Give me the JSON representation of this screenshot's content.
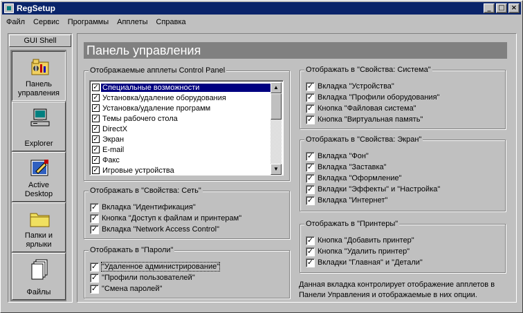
{
  "window": {
    "title": "RegSetup",
    "minimize_glyph": "_",
    "maximize_glyph": "□",
    "close_glyph": "×"
  },
  "menu": [
    "Файл",
    "Сервис",
    "Программы",
    "Апплеты",
    "Справка"
  ],
  "sidebar": {
    "header": "GUI Shell",
    "items": [
      {
        "label_line1": "Панель",
        "label_line2": "управления",
        "icon": "control-panel-icon",
        "active": true
      },
      {
        "label_line1": "Explorer",
        "label_line2": "",
        "icon": "computer-icon",
        "active": false
      },
      {
        "label_line1": "Active",
        "label_line2": "Desktop",
        "icon": "active-desktop-icon",
        "active": false
      },
      {
        "label_line1": "Папки и",
        "label_line2": "ярлыки",
        "icon": "folder-icon",
        "active": false
      },
      {
        "label_line1": "Файлы",
        "label_line2": "",
        "icon": "files-icon",
        "active": false
      }
    ]
  },
  "main": {
    "title": "Панель управления",
    "applets_group": {
      "legend": "Отображаемые апплеты Control Panel",
      "items": [
        {
          "label": "Специальные возможности",
          "checked": true,
          "selected": true
        },
        {
          "label": "Установка/удаление оборудования",
          "checked": true
        },
        {
          "label": "Установка/удаление программ",
          "checked": true
        },
        {
          "label": "Темы рабочего стола",
          "checked": true
        },
        {
          "label": "DirectX",
          "checked": true
        },
        {
          "label": "Экран",
          "checked": true
        },
        {
          "label": "E-mail",
          "checked": true
        },
        {
          "label": "Факс",
          "checked": true
        },
        {
          "label": "Игровые устройства",
          "checked": true
        }
      ]
    },
    "network_group": {
      "legend": "Отображать в \"Свойства: Сеть\"",
      "items": [
        {
          "label": "Вкладка \"Идентификация\"",
          "checked": true
        },
        {
          "label": "Кнопка \"Доступ к файлам и принтерам\"",
          "checked": true
        },
        {
          "label": "Вкладка \"Network Access Control\"",
          "checked": true
        }
      ]
    },
    "passwords_group": {
      "legend": "Отображать в \"Пароли\"",
      "items": [
        {
          "label": "\"Удаленное администрирование\"",
          "checked": true
        },
        {
          "label": "\"Профили пользователей\"",
          "checked": true
        },
        {
          "label": "\"Смена паролей\"",
          "checked": true
        }
      ]
    },
    "system_group": {
      "legend": "Отображать в \"Свойства: Система\"",
      "items": [
        {
          "label": "Вкладка \"Устройства\"",
          "checked": true
        },
        {
          "label": "Вкладка \"Профили оборудования\"",
          "checked": true
        },
        {
          "label": "Кнопка \"Файловая система\"",
          "checked": true
        },
        {
          "label": "Кнопка \"Виртуальная память\"",
          "checked": true
        }
      ]
    },
    "screen_group": {
      "legend": "Отображать в \"Свойства: Экран\"",
      "items": [
        {
          "label": "Вкладка \"Фон\"",
          "checked": true
        },
        {
          "label": "Вкладка \"Заставка\"",
          "checked": true
        },
        {
          "label": "Вкладка \"Оформление\"",
          "checked": true
        },
        {
          "label": "Вкладки \"Эффекты\" и \"Настройка\"",
          "checked": true
        },
        {
          "label": "Вкладка \"Интернет\"",
          "checked": true
        }
      ]
    },
    "printers_group": {
      "legend": "Отображать в \"Принтеры\"",
      "items": [
        {
          "label": "Кнопка \"Добавить принтер\"",
          "checked": true
        },
        {
          "label": "Кнопка \"Удалить принтер\"",
          "checked": true
        },
        {
          "label": "Вкладки \"Главная\" и \"Детали\"",
          "checked": true
        }
      ]
    },
    "description_line1": "Данная вкладка контролирует отображение апплетов в",
    "description_line2": "Панели Управления и отображаемые в них опции."
  },
  "check_glyph": "✓"
}
